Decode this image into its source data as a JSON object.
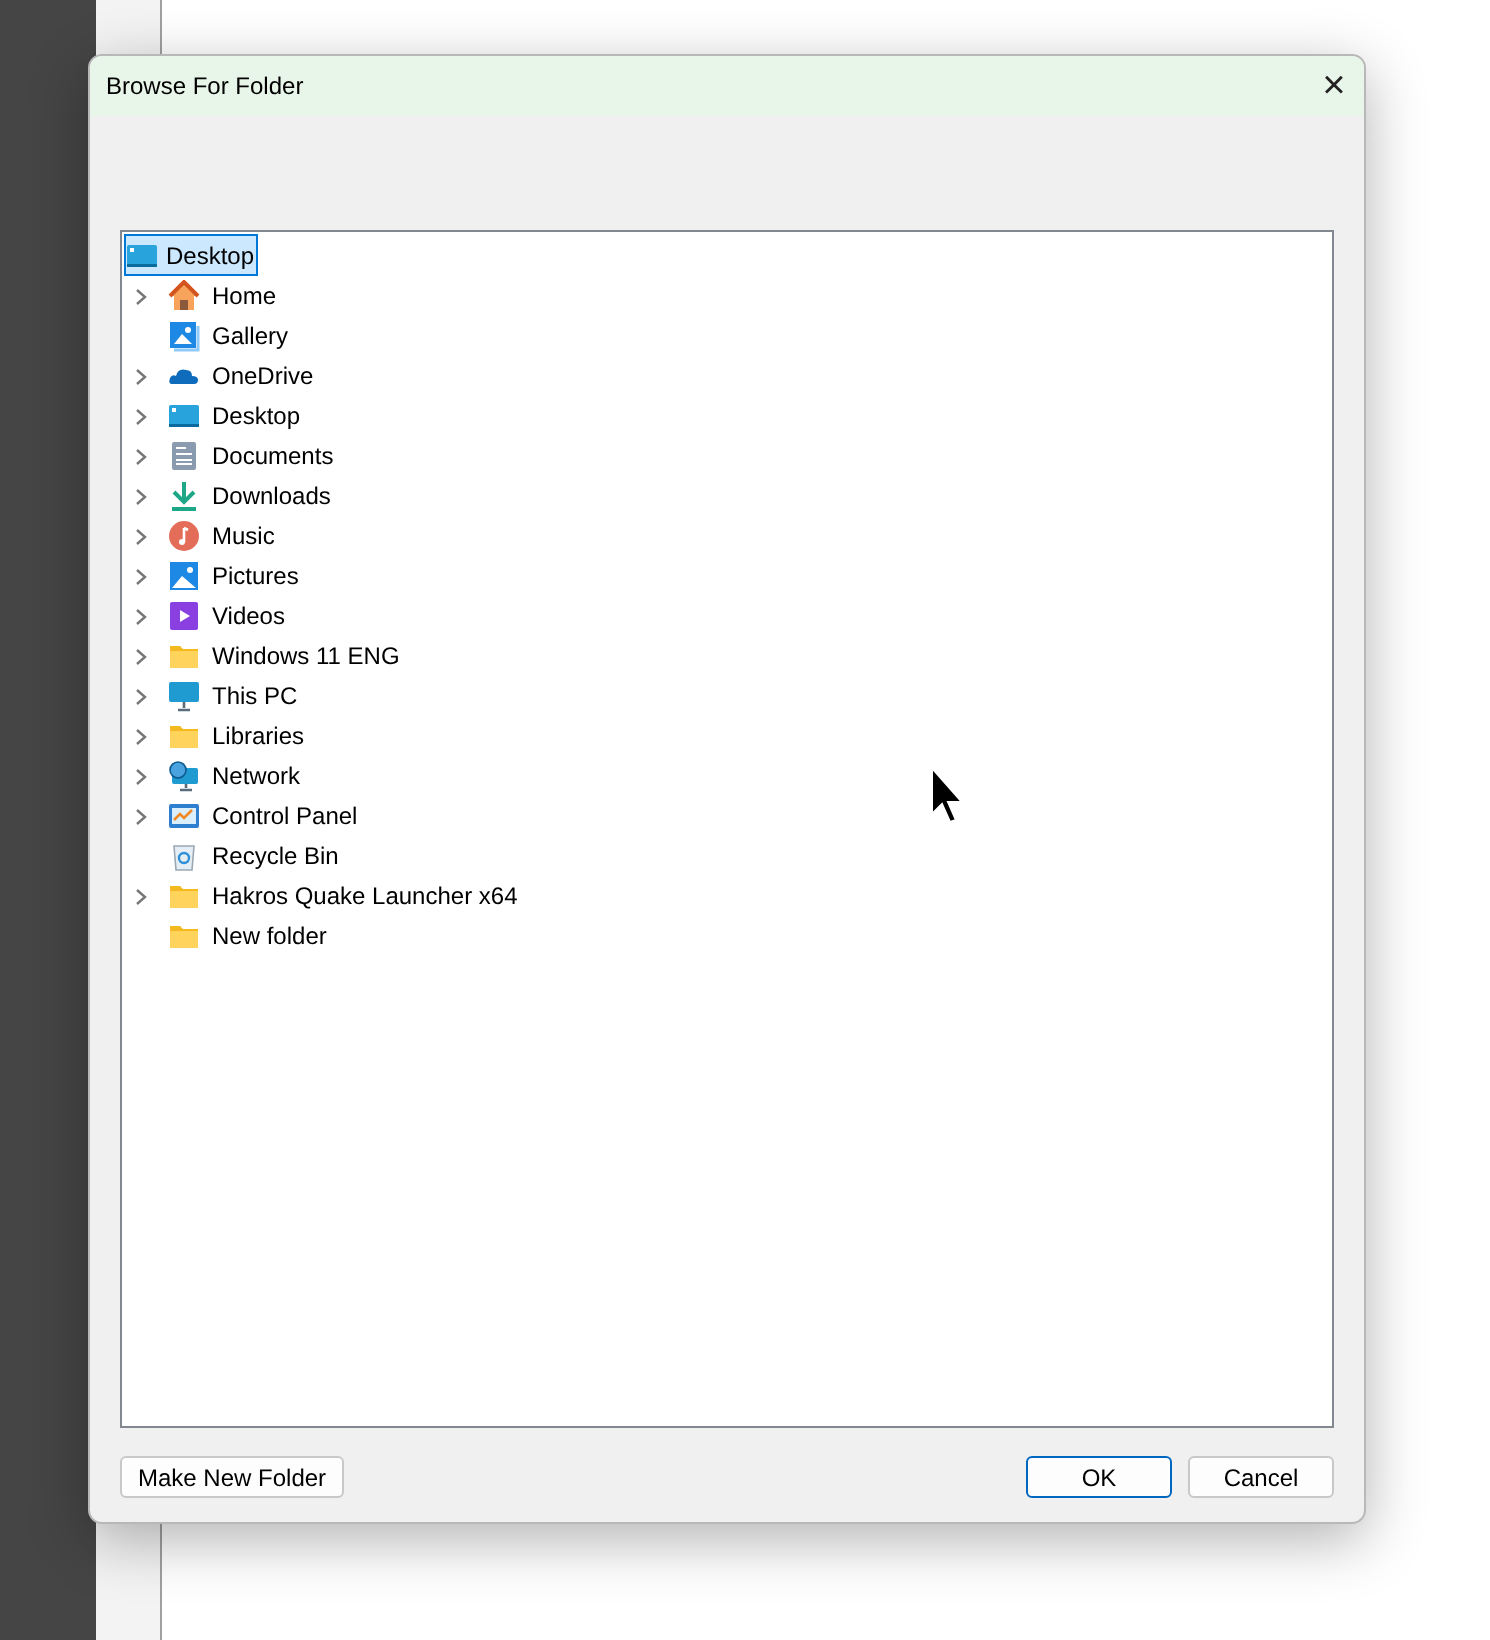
{
  "window": {
    "title": "Browse For Folder",
    "close": "×"
  },
  "tree": {
    "root": {
      "label": "Desktop",
      "kind": "desktop",
      "selected": true,
      "children": [
        {
          "label": "Home",
          "kind": "home",
          "expandable": true,
          "selected": false
        },
        {
          "label": "Gallery",
          "kind": "gallery",
          "expandable": false,
          "selected": false
        },
        {
          "label": "OneDrive",
          "kind": "cloud",
          "expandable": true,
          "selected": false
        },
        {
          "label": "Desktop",
          "kind": "desktop",
          "expandable": true,
          "selected": false
        },
        {
          "label": "Documents",
          "kind": "document",
          "expandable": true,
          "selected": false
        },
        {
          "label": "Downloads",
          "kind": "download",
          "expandable": true,
          "selected": false
        },
        {
          "label": "Music",
          "kind": "music",
          "expandable": true,
          "selected": false
        },
        {
          "label": "Pictures",
          "kind": "pictures",
          "expandable": true,
          "selected": false
        },
        {
          "label": "Videos",
          "kind": "video",
          "expandable": true,
          "selected": false
        },
        {
          "label": "Windows 11 ENG",
          "kind": "folder",
          "expandable": true,
          "selected": false
        },
        {
          "label": "This PC",
          "kind": "monitor",
          "expandable": true,
          "selected": false
        },
        {
          "label": "Libraries",
          "kind": "folder",
          "expandable": true,
          "selected": false
        },
        {
          "label": "Network",
          "kind": "network",
          "expandable": true,
          "selected": false
        },
        {
          "label": "Control Panel",
          "kind": "control",
          "expandable": true,
          "selected": false
        },
        {
          "label": "Recycle Bin",
          "kind": "recycle",
          "expandable": false,
          "selected": false
        },
        {
          "label": "Hakros Quake Launcher x64",
          "kind": "folder",
          "expandable": true,
          "selected": false
        },
        {
          "label": "New folder",
          "kind": "folder",
          "expandable": false,
          "selected": false
        }
      ]
    }
  },
  "buttons": [
    {
      "label": "Make New Folder",
      "kind": "left",
      "default": false
    },
    {
      "label": "OK",
      "kind": "right",
      "default": true
    },
    {
      "label": "Cancel",
      "kind": "right",
      "default": false
    }
  ]
}
